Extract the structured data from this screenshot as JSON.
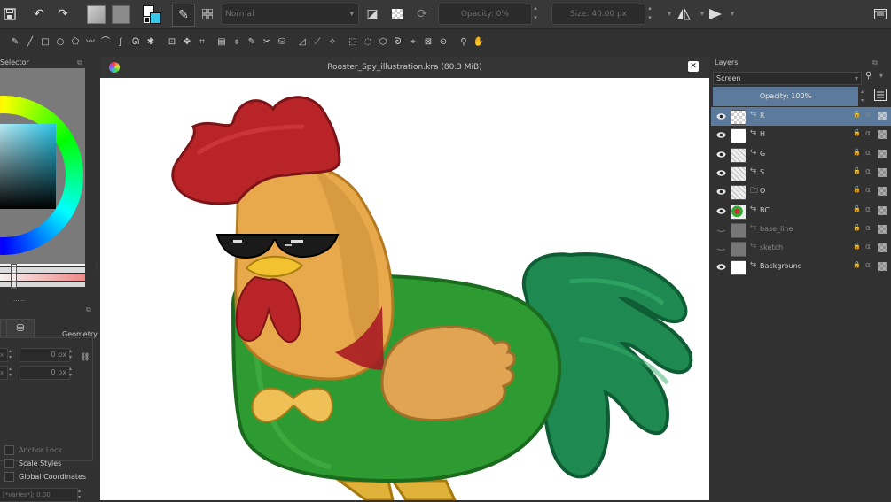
{
  "toolbar": {
    "blend_mode": "Normal",
    "opacity_label": "Opacity: 0%",
    "size_label": "Size: 40.00 px"
  },
  "left_docker": {
    "title": "Selector",
    "tool_options_tab": "Geometry",
    "field_x": "0 px",
    "field_y": "0 px",
    "anchor_lock": "Anchor Lock",
    "scale_styles": "Scale Styles",
    "global_coordinates": "Global Coordinates",
    "varies_field": "[*varies*]: 0.00",
    "dots": "......"
  },
  "document": {
    "title": "Rooster_Spy_illustration.kra (80.3 MiB)"
  },
  "layers_panel": {
    "title": "Layers",
    "blend_mode": "Screen",
    "opacity_label": "Opacity:  100%",
    "layers": [
      {
        "name": "R",
        "visible": true,
        "selected": true
      },
      {
        "name": "H",
        "visible": true,
        "selected": false
      },
      {
        "name": "G",
        "visible": true,
        "selected": false
      },
      {
        "name": "S",
        "visible": true,
        "selected": false
      },
      {
        "name": "O",
        "visible": true,
        "selected": false
      },
      {
        "name": "BC",
        "visible": true,
        "selected": false
      },
      {
        "name": "base_line",
        "visible": false,
        "selected": false
      },
      {
        "name": "sketch",
        "visible": false,
        "selected": false
      },
      {
        "name": "Background",
        "visible": true,
        "selected": false
      }
    ]
  },
  "colors": {
    "accent": "#5b7a9c",
    "canvas_bg": "#ffffff",
    "rooster_body": "#2e9a32",
    "rooster_head": "#e8a84c",
    "comb": "#b82428",
    "tail": "#1e8a52"
  }
}
